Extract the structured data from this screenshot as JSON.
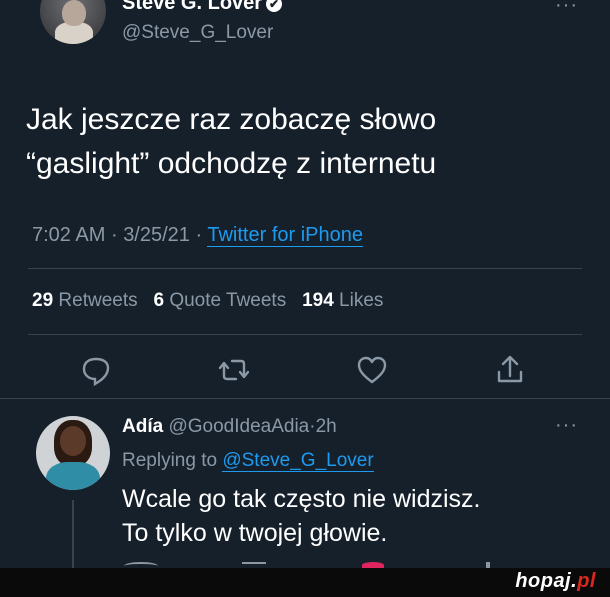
{
  "tweet": {
    "author_name": "Steve G. Lover",
    "verified_mark": "✔",
    "author_handle": "@Steve_G_Lover",
    "more_label": "···",
    "text_line1": "Jak jeszcze raz zobaczę słowo",
    "text_line2": "“gaslight” odchodzę z internetu",
    "time": "7:02 AM",
    "sep": "·",
    "date": "3/25/21",
    "source": "Twitter for iPhone",
    "stats": {
      "retweets_count": "29",
      "retweets_label": "Retweets",
      "quotes_count": "6",
      "quotes_label": "Quote Tweets",
      "likes_count": "194",
      "likes_label": "Likes"
    },
    "actions": [
      "reply-icon",
      "retweet-icon",
      "like-icon",
      "share-icon"
    ]
  },
  "reply": {
    "author_name": "Adía",
    "author_handle": "@GoodIdeaAdia",
    "age": "2h",
    "more_label": "···",
    "replying_prefix": "Replying to",
    "replying_handle": "@Steve_G_Lover",
    "text_line1": "Wcale go tak często nie widzisz.",
    "text_line2": "To tylko w twojej głowie."
  },
  "watermark": {
    "name": "hopaj",
    "dot": ".",
    "tld": "pl"
  },
  "colors": {
    "background": "#15202b",
    "accent": "#1d9bf0",
    "secondary_text": "#8b98a5",
    "divider": "#38444d"
  }
}
